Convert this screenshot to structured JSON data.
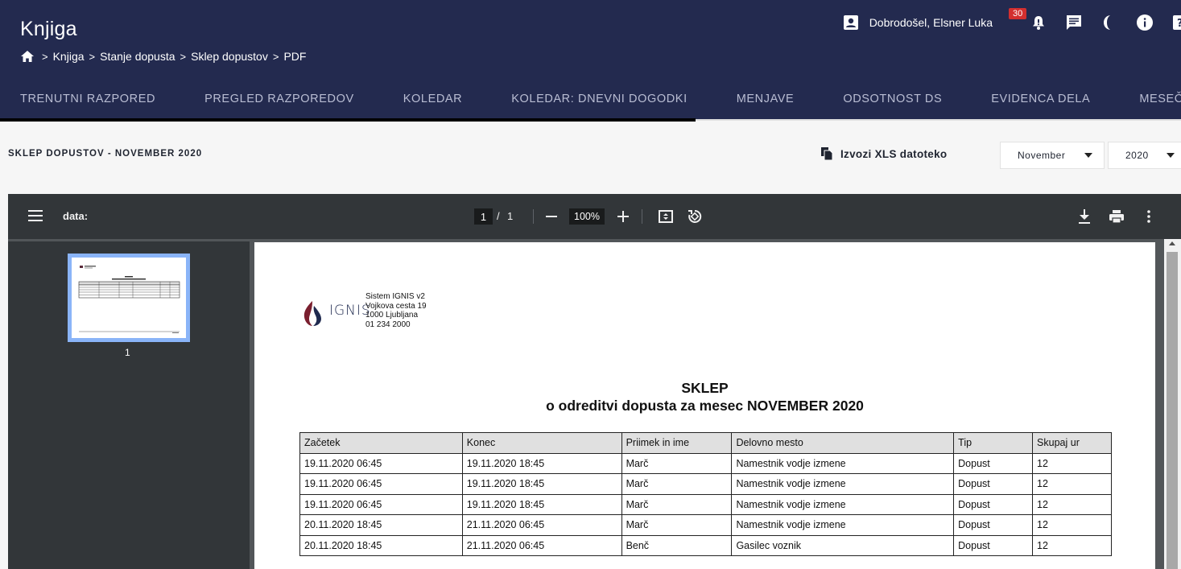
{
  "app": {
    "title": "Knjiga",
    "greeting": "Dobrodošel, Elsner Luka",
    "notification_count": "30"
  },
  "breadcrumb": [
    "Knjiga",
    "Stanje dopusta",
    "Sklep dopustov",
    "PDF"
  ],
  "tabs": [
    {
      "label": "TRENUTNI RAZPORED"
    },
    {
      "label": "PREGLED RAZPOREDOV"
    },
    {
      "label": "KOLEDAR"
    },
    {
      "label": "KOLEDAR: DNEVNI DOGODKI"
    },
    {
      "label": "MENJAVE"
    },
    {
      "label": "ODSOTNOST DS"
    },
    {
      "label": "EVIDENCA DELA"
    },
    {
      "label": "MESEČNI PL"
    }
  ],
  "toolbar": {
    "heading": "SKLEP DOPUSTOV - NOVEMBER 2020",
    "export_label": "Izvozi XLS datoteko",
    "month_value": "November",
    "year_value": "2020"
  },
  "viewer": {
    "title": "data:",
    "current_page": "1",
    "total_pages": "1",
    "zoom": "100%",
    "thumbnail_label": "1"
  },
  "document": {
    "logo_text": "IGNIS",
    "company_lines": [
      "Sistem IGNIS v2",
      "Vojkova cesta 19",
      "1000 Ljubljana",
      "01 234 2000"
    ],
    "title": "SKLEP",
    "subtitle": "o odreditvi dopusta za mesec NOVEMBER 2020",
    "table": {
      "headers": [
        "Začetek",
        "Konec",
        "Priimek in ime",
        "Delovno mesto",
        "Tip",
        "Skupaj ur"
      ],
      "rows": [
        [
          "19.11.2020 06:45",
          "19.11.2020 18:45",
          "Marč",
          "Namestnik vodje izmene",
          "Dopust",
          "12"
        ],
        [
          "19.11.2020 06:45",
          "19.11.2020 18:45",
          "Marč",
          "Namestnik vodje izmene",
          "Dopust",
          "12"
        ],
        [
          "19.11.2020 06:45",
          "19.11.2020 18:45",
          "Marč",
          "Namestnik vodje izmene",
          "Dopust",
          "12"
        ],
        [
          "20.11.2020 18:45",
          "21.11.2020 06:45",
          "Marč",
          "Namestnik vodje izmene",
          "Dopust",
          "12"
        ],
        [
          "20.11.2020 18:45",
          "21.11.2020 06:45",
          "Benč",
          "Gasilec voznik",
          "Dopust",
          "12"
        ]
      ]
    }
  },
  "colors": {
    "header_bg": "#232a4f",
    "active_tab_underline": "#000000",
    "badge": "#d32f2f",
    "viewer_toolbar": "#323639",
    "thumbnail_highlight": "#8ab4f8"
  }
}
